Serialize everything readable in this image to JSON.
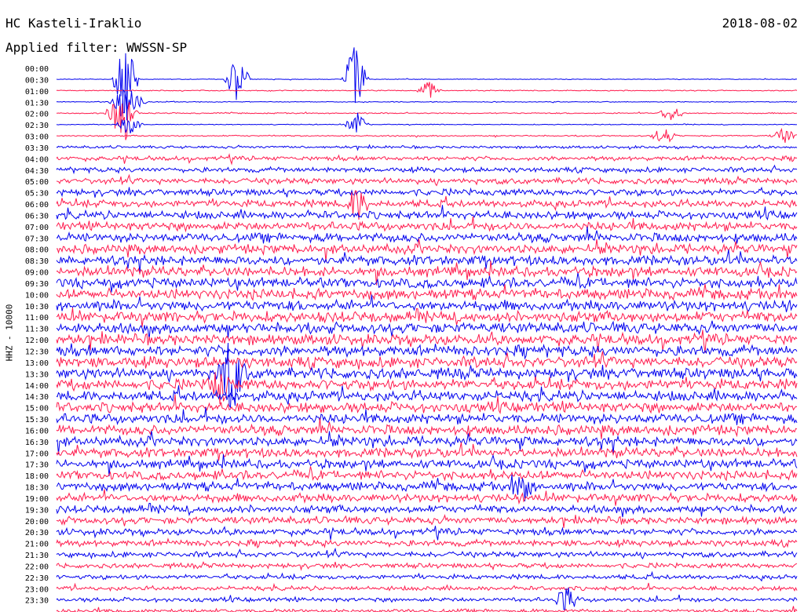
{
  "header": {
    "station": "HC Kasteli-Iraklio",
    "date": "2018-08-02",
    "filter": "Applied filter: WWSSN-SP",
    "channel": "HHZ - 10000"
  },
  "chart_data": {
    "type": "line",
    "title": "HC Kasteli-Iraklio",
    "subtitle": "Applied filter: WWSSN-SP",
    "ylabel": "HHZ - 10000",
    "colors": [
      "#0000ee",
      "#ff1a4d"
    ],
    "rows": [
      {
        "label": "00:00",
        "amp": 0.4,
        "color": "#0000ee"
      },
      {
        "label": "00:30",
        "amp": 0.6,
        "color": "#ff1a4d"
      },
      {
        "label": "01:00",
        "amp": 0.5,
        "color": "#0000ee"
      },
      {
        "label": "01:30",
        "amp": 0.7,
        "color": "#ff1a4d"
      },
      {
        "label": "02:00",
        "amp": 0.5,
        "color": "#0000ee"
      },
      {
        "label": "02:30",
        "amp": 0.8,
        "color": "#ff1a4d"
      },
      {
        "label": "03:00",
        "amp": 1.6,
        "color": "#0000ee"
      },
      {
        "label": "03:30",
        "amp": 2.6,
        "color": "#ff1a4d"
      },
      {
        "label": "04:00",
        "amp": 3.0,
        "color": "#0000ee"
      },
      {
        "label": "04:30",
        "amp": 3.6,
        "color": "#ff1a4d"
      },
      {
        "label": "05:00",
        "amp": 4.0,
        "color": "#0000ee"
      },
      {
        "label": "05:30",
        "amp": 4.4,
        "color": "#ff1a4d"
      },
      {
        "label": "06:00",
        "amp": 4.8,
        "color": "#0000ee"
      },
      {
        "label": "06:30",
        "amp": 5.2,
        "color": "#ff1a4d"
      },
      {
        "label": "07:00",
        "amp": 5.4,
        "color": "#0000ee"
      },
      {
        "label": "07:30",
        "amp": 5.6,
        "color": "#ff1a4d"
      },
      {
        "label": "08:00",
        "amp": 5.8,
        "color": "#0000ee"
      },
      {
        "label": "08:30",
        "amp": 6.0,
        "color": "#ff1a4d"
      },
      {
        "label": "09:00",
        "amp": 6.0,
        "color": "#0000ee"
      },
      {
        "label": "09:30",
        "amp": 6.2,
        "color": "#ff1a4d"
      },
      {
        "label": "10:00",
        "amp": 6.2,
        "color": "#0000ee"
      },
      {
        "label": "10:30",
        "amp": 6.4,
        "color": "#ff1a4d"
      },
      {
        "label": "11:00",
        "amp": 6.4,
        "color": "#0000ee"
      },
      {
        "label": "11:30",
        "amp": 6.4,
        "color": "#ff1a4d"
      },
      {
        "label": "12:00",
        "amp": 6.4,
        "color": "#0000ee"
      },
      {
        "label": "12:30",
        "amp": 6.6,
        "color": "#ff1a4d"
      },
      {
        "label": "13:00",
        "amp": 6.6,
        "color": "#0000ee"
      },
      {
        "label": "13:30",
        "amp": 6.4,
        "color": "#ff1a4d"
      },
      {
        "label": "14:00",
        "amp": 6.2,
        "color": "#0000ee"
      },
      {
        "label": "14:30",
        "amp": 6.2,
        "color": "#ff1a4d"
      },
      {
        "label": "15:00",
        "amp": 6.0,
        "color": "#0000ee"
      },
      {
        "label": "15:30",
        "amp": 6.0,
        "color": "#ff1a4d"
      },
      {
        "label": "16:00",
        "amp": 5.8,
        "color": "#0000ee"
      },
      {
        "label": "16:30",
        "amp": 5.6,
        "color": "#ff1a4d"
      },
      {
        "label": "17:00",
        "amp": 5.4,
        "color": "#0000ee"
      },
      {
        "label": "17:30",
        "amp": 5.4,
        "color": "#ff1a4d"
      },
      {
        "label": "18:00",
        "amp": 5.2,
        "color": "#0000ee"
      },
      {
        "label": "18:30",
        "amp": 5.0,
        "color": "#ff1a4d"
      },
      {
        "label": "19:00",
        "amp": 4.6,
        "color": "#0000ee"
      },
      {
        "label": "19:30",
        "amp": 4.4,
        "color": "#ff1a4d"
      },
      {
        "label": "20:00",
        "amp": 4.0,
        "color": "#0000ee"
      },
      {
        "label": "20:30",
        "amp": 3.8,
        "color": "#ff1a4d"
      },
      {
        "label": "21:00",
        "amp": 3.4,
        "color": "#0000ee"
      },
      {
        "label": "21:30",
        "amp": 3.0,
        "color": "#ff1a4d"
      },
      {
        "label": "22:00",
        "amp": 2.8,
        "color": "#0000ee"
      },
      {
        "label": "22:30",
        "amp": 2.6,
        "color": "#ff1a4d"
      },
      {
        "label": "23:00",
        "amp": 2.6,
        "color": "#0000ee"
      },
      {
        "label": "23:30",
        "amp": 2.4,
        "color": "#ff1a4d"
      }
    ]
  }
}
